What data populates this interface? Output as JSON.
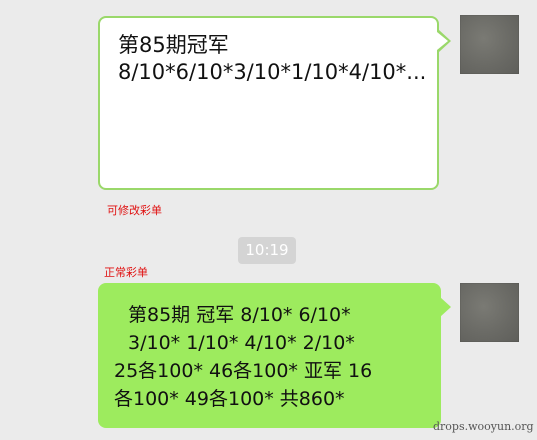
{
  "messages": [
    {
      "lines": [
        "第85期冠军",
        "8/10*6/10*3/10*1/10*4/10*..."
      ],
      "label": "可修改彩单"
    },
    {
      "lines": [
        "第85期   冠军  8/10*  6/10*",
        "3/10*  1/10*  4/10*  2/10*",
        "25各100*  46各100* 亚军 16",
        "各100* 49各100* 共860*"
      ],
      "label": "正常彩单"
    }
  ],
  "timestamp": "10:19",
  "watermark": "drops.wooyun.org",
  "colors": {
    "background": "#ebebeb",
    "bubble_green": "#9deb5e",
    "bubble_border": "#9ad86a",
    "label_red": "#e01010"
  }
}
